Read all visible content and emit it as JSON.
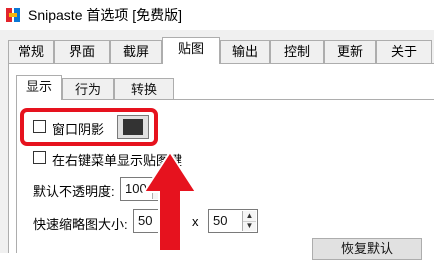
{
  "window": {
    "title": "Snipaste 首选项 [免费版]"
  },
  "tabs": [
    {
      "label": "常规"
    },
    {
      "label": "界面"
    },
    {
      "label": "截屏"
    },
    {
      "label": "贴图"
    },
    {
      "label": "输出"
    },
    {
      "label": "控制"
    },
    {
      "label": "更新"
    },
    {
      "label": "关于"
    }
  ],
  "active_tab": "贴图",
  "subtabs": [
    {
      "label": "显示"
    },
    {
      "label": "行为"
    },
    {
      "label": "转换"
    }
  ],
  "active_subtab": "显示",
  "options": {
    "window_shadow": {
      "label": "窗口阴影",
      "checked": false,
      "color": "#333333"
    },
    "right_menu": {
      "label": "在右键菜单显示贴图键",
      "checked": false
    },
    "opacity": {
      "label": "默认不透明度:",
      "value": "100",
      "unit": "%"
    },
    "thumb_size": {
      "label": "快速缩略图大小:",
      "width": "50",
      "x_label": "x",
      "height": "50"
    }
  },
  "restore_button": {
    "label": "恢复默认"
  },
  "accent_colors": {
    "highlight": "#e6121e",
    "arrow": "#e6121e"
  }
}
